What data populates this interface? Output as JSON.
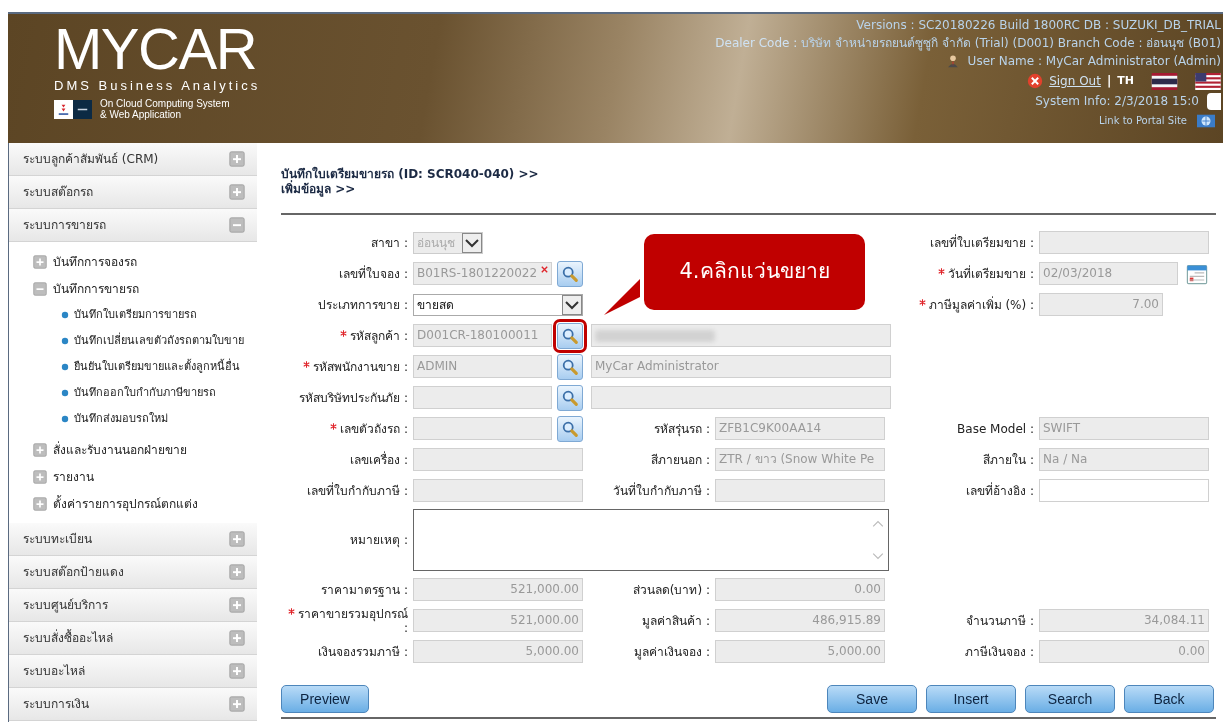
{
  "header": {
    "logo": "MYCAR",
    "subtitle": "DMS Business Analytics",
    "tagline": [
      "On Cloud Computing System",
      "& Web Application"
    ],
    "versions": "Versions : SC20180226 Build 1800RC DB : SUZUKI_DB_TRIAL",
    "dealer_label": "Dealer Code :",
    "dealer": "บริษัท จำหน่ายรถยนต์ซูซูกิ จำกัด (Trial) (D001)  Branch Code : อ่อนนุช (B01)",
    "user": "User Name : MyCar Administrator  (Admin)",
    "sign_out": "Sign Out",
    "separator": "|",
    "language": "TH",
    "system_info": "System Info: 2/3/2018 15:0",
    "checkbox": {
      "checked": false
    },
    "portal_link": "Link to Portal Site"
  },
  "sidebar": {
    "items": [
      {
        "label": "ระบบลูกค้าสัมพันธ์ (CRM)",
        "expanded": false
      },
      {
        "label": "ระบบสต๊อกรถ",
        "expanded": false
      },
      {
        "label": "ระบบการขายรถ",
        "expanded": true,
        "children": [
          {
            "label": "บันทึกการจองรถ",
            "expanded": false
          },
          {
            "label": "บันทึกการขายรถ",
            "expanded": true,
            "children": [
              {
                "label": "บันทึกใบเตรียมการขายรถ"
              },
              {
                "label": "บันทึกเปลี่ยนเลขตัวถังรถตามใบขาย"
              },
              {
                "label": "ยืนยันใบเตรียมขายและตั้งลูกหนี้อื่น"
              },
              {
                "label": "บันทึกออกใบกำกับภาษีขายรถ"
              },
              {
                "label": "บันทึกส่งมอบรถใหม่"
              }
            ]
          },
          {
            "label": "สั่งและรับงานนอกฝ่ายขาย",
            "expanded": false
          },
          {
            "label": "รายงาน",
            "expanded": false
          },
          {
            "label": "ตั้งค่ารายการอุปกรณ์ตกแต่ง",
            "expanded": false
          }
        ]
      },
      {
        "label": "ระบบทะเบียน",
        "expanded": false
      },
      {
        "label": "ระบบสต๊อกป้ายแดง",
        "expanded": false
      },
      {
        "label": "ระบบศูนย์บริการ",
        "expanded": false
      },
      {
        "label": "ระบบสั่งซื้ออะไหล่",
        "expanded": false
      },
      {
        "label": "ระบบอะไหล่",
        "expanded": false
      },
      {
        "label": "ระบบการเงิน",
        "expanded": false
      }
    ]
  },
  "page": {
    "title": [
      "บันทึกใบเตรียมขายรถ (ID: SCR040-040) >>",
      "เพิ่มข้อมูล >>"
    ]
  },
  "form": {
    "rows": [
      {
        "left": {
          "label": "สาขา :",
          "required": false,
          "controls": [
            {
              "kind": "select",
              "value": "อ่อนนุช",
              "disabled": true
            }
          ]
        },
        "right": {
          "label": "เลขที่ใบเตรียมขาย :",
          "required": false,
          "controls": [
            {
              "kind": "text"
            }
          ]
        }
      },
      {
        "left": {
          "label": "เลขที่ใบจอง :",
          "required": false,
          "controls": [
            {
              "kind": "text",
              "value": "B01RS-1801220022",
              "clearable": true
            },
            {
              "kind": "lookup",
              "highlighted": false
            }
          ]
        },
        "right": {
          "label": "วันที่เตรียมขาย :",
          "required": true,
          "controls": [
            {
              "kind": "text",
              "value": "02/03/2018"
            },
            {
              "kind": "calendar"
            }
          ]
        }
      },
      {
        "left": {
          "label": "ประเภทการขาย :",
          "required": false,
          "controls": [
            {
              "kind": "select",
              "value": "ขายสด",
              "disabled": false
            }
          ]
        },
        "right": {
          "label": "ภาษีมูลค่าเพิ่ม (%) :",
          "required": true,
          "controls": [
            {
              "kind": "number",
              "value": "7.00"
            }
          ]
        }
      },
      {
        "left": {
          "label": "รหัสลูกค้า :",
          "required": true,
          "controls": [
            {
              "kind": "text",
              "value": "D001CR-180100011"
            },
            {
              "kind": "lookup",
              "highlighted": true
            }
          ]
        },
        "middle": {
          "controls": [
            {
              "kind": "name",
              "redacted": true
            }
          ]
        }
      },
      {
        "left": {
          "label": "รหัสพนักงานขาย :",
          "required": true,
          "controls": [
            {
              "kind": "text",
              "value": "ADMIN"
            },
            {
              "kind": "lookup",
              "highlighted": false
            }
          ]
        },
        "middle": {
          "controls": [
            {
              "kind": "name",
              "value": "MyCar Administrator"
            }
          ]
        }
      },
      {
        "left": {
          "label": "รหัสบริษัทประกันภัย :",
          "required": false,
          "controls": [
            {
              "kind": "text"
            },
            {
              "kind": "lookup",
              "highlighted": false
            }
          ]
        },
        "middle": {
          "controls": [
            {
              "kind": "name"
            }
          ]
        }
      },
      {
        "left": {
          "label": "เลขตัวถังรถ :",
          "required": true,
          "controls": [
            {
              "kind": "text"
            },
            {
              "kind": "lookup",
              "highlighted": false
            }
          ]
        },
        "middle": {
          "label": "รหัสรุ่นรถ :",
          "required": false,
          "controls": [
            {
              "kind": "text",
              "value": "ZFB1C9K00AA14"
            }
          ]
        },
        "right": {
          "label": "Base Model :",
          "required": false,
          "controls": [
            {
              "kind": "text",
              "value": "SWIFT"
            }
          ]
        }
      },
      {
        "left": {
          "label": "เลขเครื่อง :",
          "required": false,
          "controls": [
            {
              "kind": "text"
            }
          ]
        },
        "middle": {
          "label": "สีภายนอก :",
          "required": false,
          "controls": [
            {
              "kind": "text",
              "value": "ZTR / ขาว (Snow White Pe"
            }
          ]
        },
        "right": {
          "label": "สีภายใน :",
          "required": false,
          "controls": [
            {
              "kind": "text",
              "value": "Na / Na"
            }
          ]
        }
      },
      {
        "left": {
          "label": "เลขที่ใบกำกับภาษี :",
          "required": false,
          "controls": [
            {
              "kind": "text"
            }
          ]
        },
        "middle": {
          "label": "วันที่ใบกำกับภาษี :",
          "required": false,
          "controls": [
            {
              "kind": "text"
            }
          ]
        },
        "right": {
          "label": "เลขที่อ้างอิง :",
          "required": false,
          "controls": [
            {
              "kind": "input"
            }
          ]
        }
      },
      {
        "left": {
          "label": "หมายเหตุ :",
          "required": false,
          "controls": [
            {
              "kind": "memo"
            }
          ]
        }
      },
      {
        "left": {
          "label": "ราคามาตรฐาน :",
          "required": false,
          "controls": [
            {
              "kind": "number",
              "value": "521,000.00"
            }
          ]
        },
        "middle": {
          "label": "ส่วนลด(บาท) :",
          "required": false,
          "controls": [
            {
              "kind": "number",
              "value": "0.00"
            }
          ]
        }
      },
      {
        "left": {
          "label": "ราคาขายรวมอุปกรณ์ :",
          "required": true,
          "controls": [
            {
              "kind": "number",
              "value": "521,000.00"
            }
          ]
        },
        "middle": {
          "label": "มูลค่าสินค้า :",
          "required": false,
          "controls": [
            {
              "kind": "number",
              "value": "486,915.89"
            }
          ]
        },
        "right": {
          "label": "จำนวนภาษี :",
          "required": false,
          "controls": [
            {
              "kind": "number",
              "value": "34,084.11"
            }
          ]
        }
      },
      {
        "left": {
          "label": "เงินจองรวมภาษี :",
          "required": false,
          "controls": [
            {
              "kind": "number",
              "value": "5,000.00"
            }
          ]
        },
        "middle": {
          "label": "มูลค่าเงินจอง :",
          "required": false,
          "controls": [
            {
              "kind": "number",
              "value": "5,000.00"
            }
          ]
        },
        "right": {
          "label": "ภาษีเงินจอง :",
          "required": false,
          "controls": [
            {
              "kind": "number",
              "value": "0.00"
            }
          ]
        }
      }
    ]
  },
  "callout": {
    "text": "4.คลิกแว่นขยาย"
  },
  "buttons": {
    "left": [
      "Preview"
    ],
    "right": [
      "Save",
      "Insert",
      "Search",
      "Back"
    ]
  }
}
